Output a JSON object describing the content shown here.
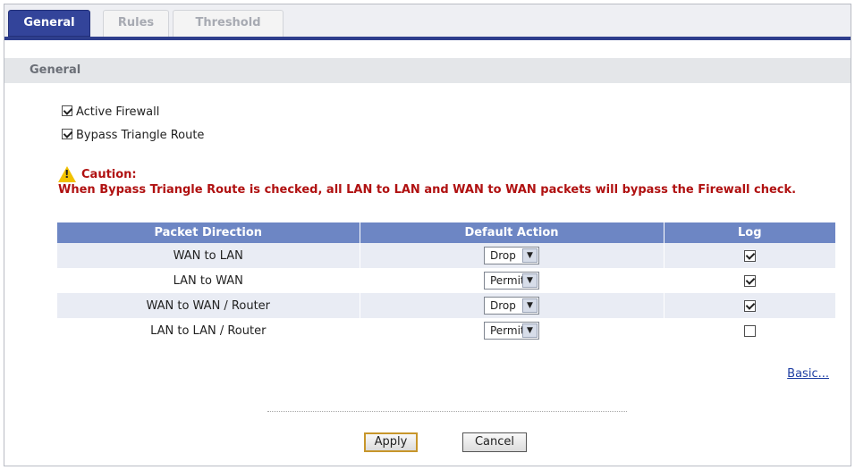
{
  "tabs": [
    {
      "label": "General",
      "active": true
    },
    {
      "label": "Rules",
      "active": false
    },
    {
      "label": "Threshold",
      "active": false
    }
  ],
  "section_title": "General",
  "options": {
    "active_firewall": {
      "label": "Active Firewall",
      "checked": true
    },
    "bypass_triangle": {
      "label": "Bypass Triangle Route",
      "checked": true
    }
  },
  "caution": {
    "title": "Caution:",
    "text": "When Bypass Triangle Route is checked, all LAN to LAN and WAN to WAN packets will bypass the Firewall check.",
    "icon": "warning-triangle-icon"
  },
  "table": {
    "headers": [
      "Packet Direction",
      "Default Action",
      "Log"
    ],
    "rows": [
      {
        "direction": "WAN to LAN",
        "action": "Drop",
        "log": true
      },
      {
        "direction": "LAN to WAN",
        "action": "Permit",
        "log": true
      },
      {
        "direction": "WAN to WAN / Router",
        "action": "Drop",
        "log": true
      },
      {
        "direction": "LAN to LAN / Router",
        "action": "Permit",
        "log": false
      }
    ]
  },
  "basic_link": "Basic...",
  "buttons": {
    "apply": "Apply",
    "cancel": "Cancel"
  },
  "colors": {
    "tab_active": "#33449a",
    "header_bar": "#6d86c4",
    "caution": "#b01111"
  }
}
